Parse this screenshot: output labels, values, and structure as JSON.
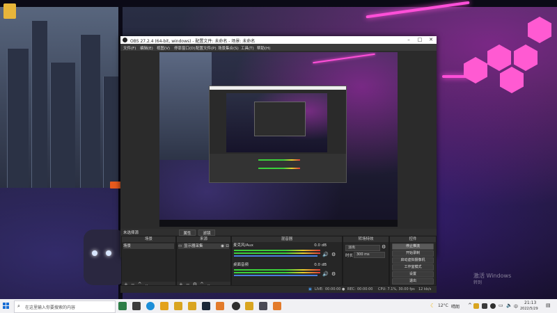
{
  "obs": {
    "title": "OBS 27.2.4 (64-bit, windows) - 配置文件: 未命名 - 场景: 未命名",
    "menu": [
      "文件(F)",
      "编辑(E)",
      "视图(V)",
      "停靠窗口(D)",
      "配置文件(P)",
      "场景集合(S)",
      "工具(T)",
      "帮助(H)"
    ],
    "sources_bar": {
      "label": "未选择源",
      "properties": "属性",
      "filters": "滤镜"
    },
    "scenes": {
      "title": "场景",
      "items": [
        "场景"
      ]
    },
    "sources": {
      "title": "来源",
      "items": [
        "显示器采集"
      ]
    },
    "mixer": {
      "title": "混音器",
      "channels": [
        {
          "name": "麦克风/Aux",
          "db": "0.0 dB"
        },
        {
          "name": "桌面音频",
          "db": "0.0 dB"
        }
      ]
    },
    "transitions": {
      "title": "转场特效",
      "type": "淡出",
      "duration_label": "时长",
      "duration": "300 ms"
    },
    "controls": {
      "title": "控件",
      "buttons": [
        "停止推流",
        "开始录制",
        "启动虚拟摄像机",
        "工作室模式",
        "设置",
        "退出"
      ]
    },
    "status": {
      "live": "LIVE:",
      "live_time": "00:00:00",
      "rec": "REC:",
      "rec_time": "00:00:00",
      "cpu": "CPU: 7.1%, 30.00 fps",
      "kbps": "12 kb/s"
    }
  },
  "desktop": {
    "watermark_line1": "激活 Windows",
    "watermark_line2": "转到"
  },
  "taskbar": {
    "search_placeholder": "在这里输入你要搜索的内容",
    "weather": "12°C",
    "weather_desc": "晴朗",
    "time": "21:13",
    "date": "2022/5/29",
    "lang": "中"
  },
  "colors": {
    "neon": "#ff4fd8",
    "obs_bg": "#2b2b2b",
    "taskbar": "#f1f1f4"
  }
}
